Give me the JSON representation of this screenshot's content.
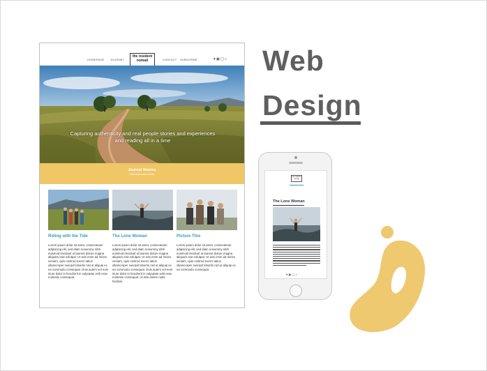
{
  "slide": {
    "title_line1": "Web",
    "title_line2": "Design"
  },
  "desktop_site": {
    "nav": [
      "HOMEPAGE",
      "JOURNEY",
      "CONTACT",
      "SUBSCRIBE"
    ],
    "logo": "the resident nomad",
    "social_icons": "♥▣◯⌕",
    "hero_tagline": "Capturing authenticity and real people stories and experiences and reading all in a time",
    "band_title": "Journal Stories",
    "band_subtitle": "Adventures and stories",
    "cards": [
      {
        "title": "Riding with the Tide",
        "body": "Lorem ipsum dolor sit amet, consectetuer adipiscing elit, sed diam nonummy nibh euismod tincidunt ut laoreet dolore magna aliquam erat volutpat. Ut wisi enim ad minim veniam, quis nostrud exerci tation ullamcorper suscipit lobortis nisl ut aliquip ex ea commodo consequat. Duis autem vel eum iriure dolor in hendrerit in vulputate velit esse molestie consequat."
      },
      {
        "title": "The Lone Woman",
        "body": "Lorem ipsum dolor sit amet, consectetuer adipiscing elit, sed diam nonummy nibh euismod tincidunt ut laoreet dolore magna aliquam erat volutpat. Ut wisi enim ad minim veniam, quis nostrud exerci tation ullamcorper suscipit lobortis nisl ut aliquip ex ea commodo consequat. Duis autem vel eum iriure dolor in hendrerit in vulputate velit esse molestie consequat. Ut wisi dolore nulla facilisis."
      },
      {
        "title": "Picture This",
        "body": "Lorem ipsum dolor sit amet, consectetuer adipiscing elit, sed diam nonummy nibh euismod tincidunt ut laoreet dolore magna aliquam erat volutpat. Ut wisi enim ad minim veniam, quis nostrud exerci tation ullamcorper suscipit lobortis nisl ut aliquip ex ea commodo consequat."
      }
    ]
  },
  "mobile_site": {
    "logo": "the resident nomad",
    "article_title": "The Lone Woman",
    "social_icons": "♥▣◯⌕"
  },
  "colors": {
    "accent_yellow": "#f0c766",
    "accent_teal": "#3a9bb5",
    "title_gray": "#5f5f5f"
  }
}
